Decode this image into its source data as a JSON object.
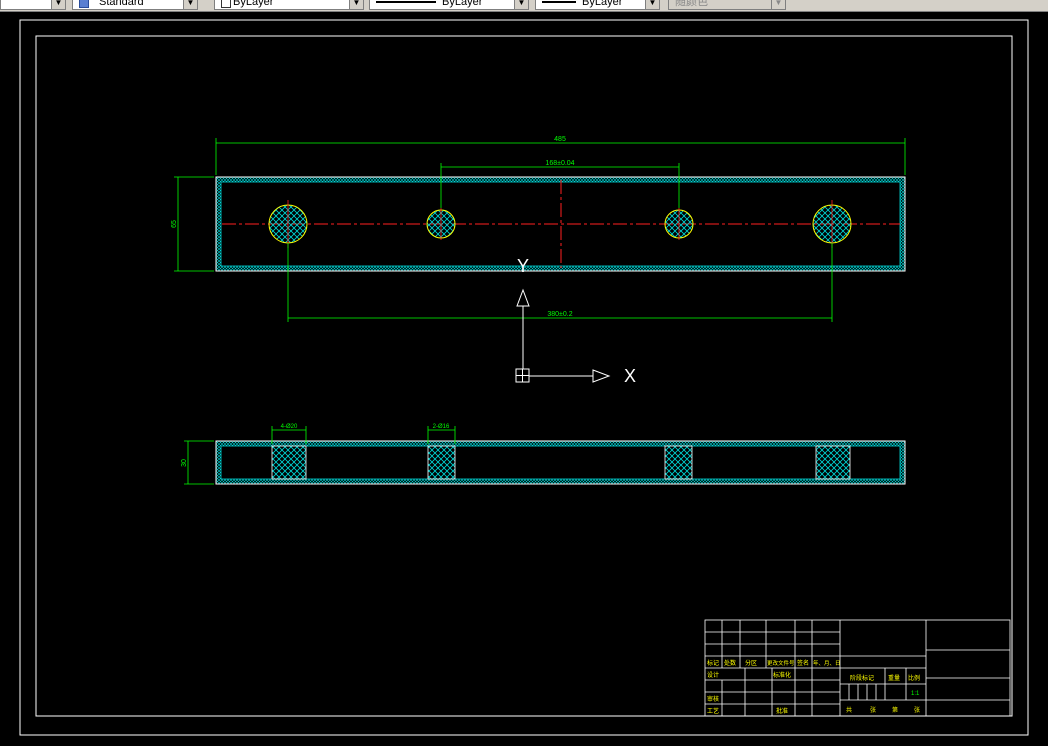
{
  "toolbar": {
    "dim_style": "Standard",
    "layer": "ByLayer",
    "linetype": "ByLayer",
    "lineweight": "ByLayer",
    "plot_style": "随颜色"
  },
  "drawing": {
    "dims": {
      "overall_length": "485",
      "center_spacing": "168±0.04",
      "outer_spacing": "380±0.2",
      "height": "65",
      "thickness": "30",
      "large_hole": "4-Ø20",
      "small_hole": "2-Ø16"
    },
    "ucs": {
      "x_label": "X",
      "y_label": "Y"
    },
    "colors": {
      "outline": "#ffffff",
      "dimension": "#00ff00",
      "hatch": "#00e5e5",
      "center": "#ff2020",
      "hole": "#ffff00"
    }
  },
  "title_block": {
    "revision_headers": [
      "标记",
      "处数",
      "分区",
      "更改文件号",
      "签名",
      "年、月、日"
    ],
    "design": "设计",
    "standardize": "标准化",
    "process": "工艺",
    "review": "审核",
    "approve": "批准",
    "stage_mark": "阶段标记",
    "weight": "重量",
    "scale_label": "比例",
    "scale": "1:1",
    "sheets_total": "共",
    "sheets_unit": "张",
    "sheet_num": "第",
    "sheet_unit": "张"
  }
}
